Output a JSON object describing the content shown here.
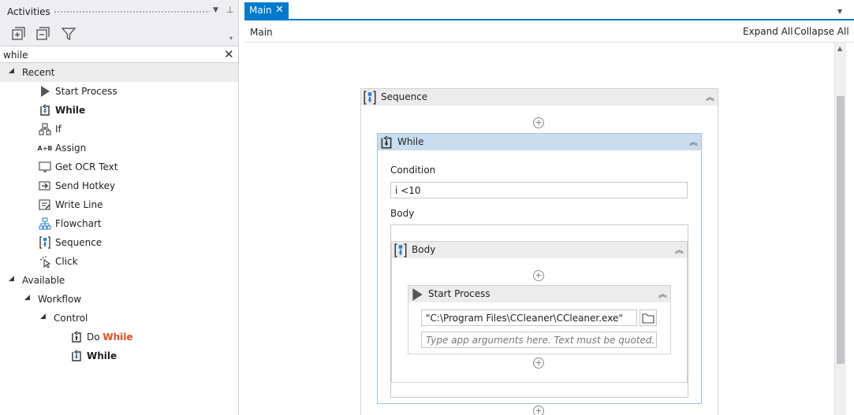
{
  "activities_panel": {
    "title": "Activities",
    "search_value": "while",
    "tree": {
      "recent_label": "Recent",
      "recent_items": [
        {
          "label": "Start Process",
          "icon": "play-icon"
        },
        {
          "label": "While",
          "icon": "while-loop-icon",
          "highlight": true
        },
        {
          "label": "If",
          "icon": "if-icon"
        },
        {
          "label": "Assign",
          "icon": "assign-icon"
        },
        {
          "label": "Get OCR Text",
          "icon": "ocr-icon"
        },
        {
          "label": "Send Hotkey",
          "icon": "hotkey-icon"
        },
        {
          "label": "Write Line",
          "icon": "write-line-icon"
        },
        {
          "label": "Flowchart",
          "icon": "flowchart-icon"
        },
        {
          "label": "Sequence",
          "icon": "sequence-icon"
        },
        {
          "label": "Click",
          "icon": "click-icon"
        }
      ],
      "available_label": "Available",
      "workflow_label": "Workflow",
      "control_label": "Control",
      "control_items": [
        {
          "prefix": "Do ",
          "highlight": "While",
          "icon": "do-while-icon"
        },
        {
          "prefix": "",
          "highlight": "While",
          "icon": "while-loop-icon"
        }
      ]
    }
  },
  "designer": {
    "tab_label": "Main",
    "breadcrumb": "Main",
    "expand_all": "Expand All",
    "collapse_all": "Collapse All",
    "sequence": {
      "title": "Sequence",
      "while": {
        "title": "While",
        "condition_label": "Condition",
        "condition_value": "i <10",
        "body_label": "Body",
        "body": {
          "title": "Body",
          "start_process": {
            "title": "Start Process",
            "file_path": "\"C:\\Program Files\\CCleaner\\CCleaner.exe\"",
            "args_placeholder": "Type app arguments here. Text must be quoted."
          }
        }
      }
    }
  },
  "colors": {
    "accent": "#007acc",
    "highlight": "#e84b26",
    "selected_header": "#c9ddef"
  }
}
